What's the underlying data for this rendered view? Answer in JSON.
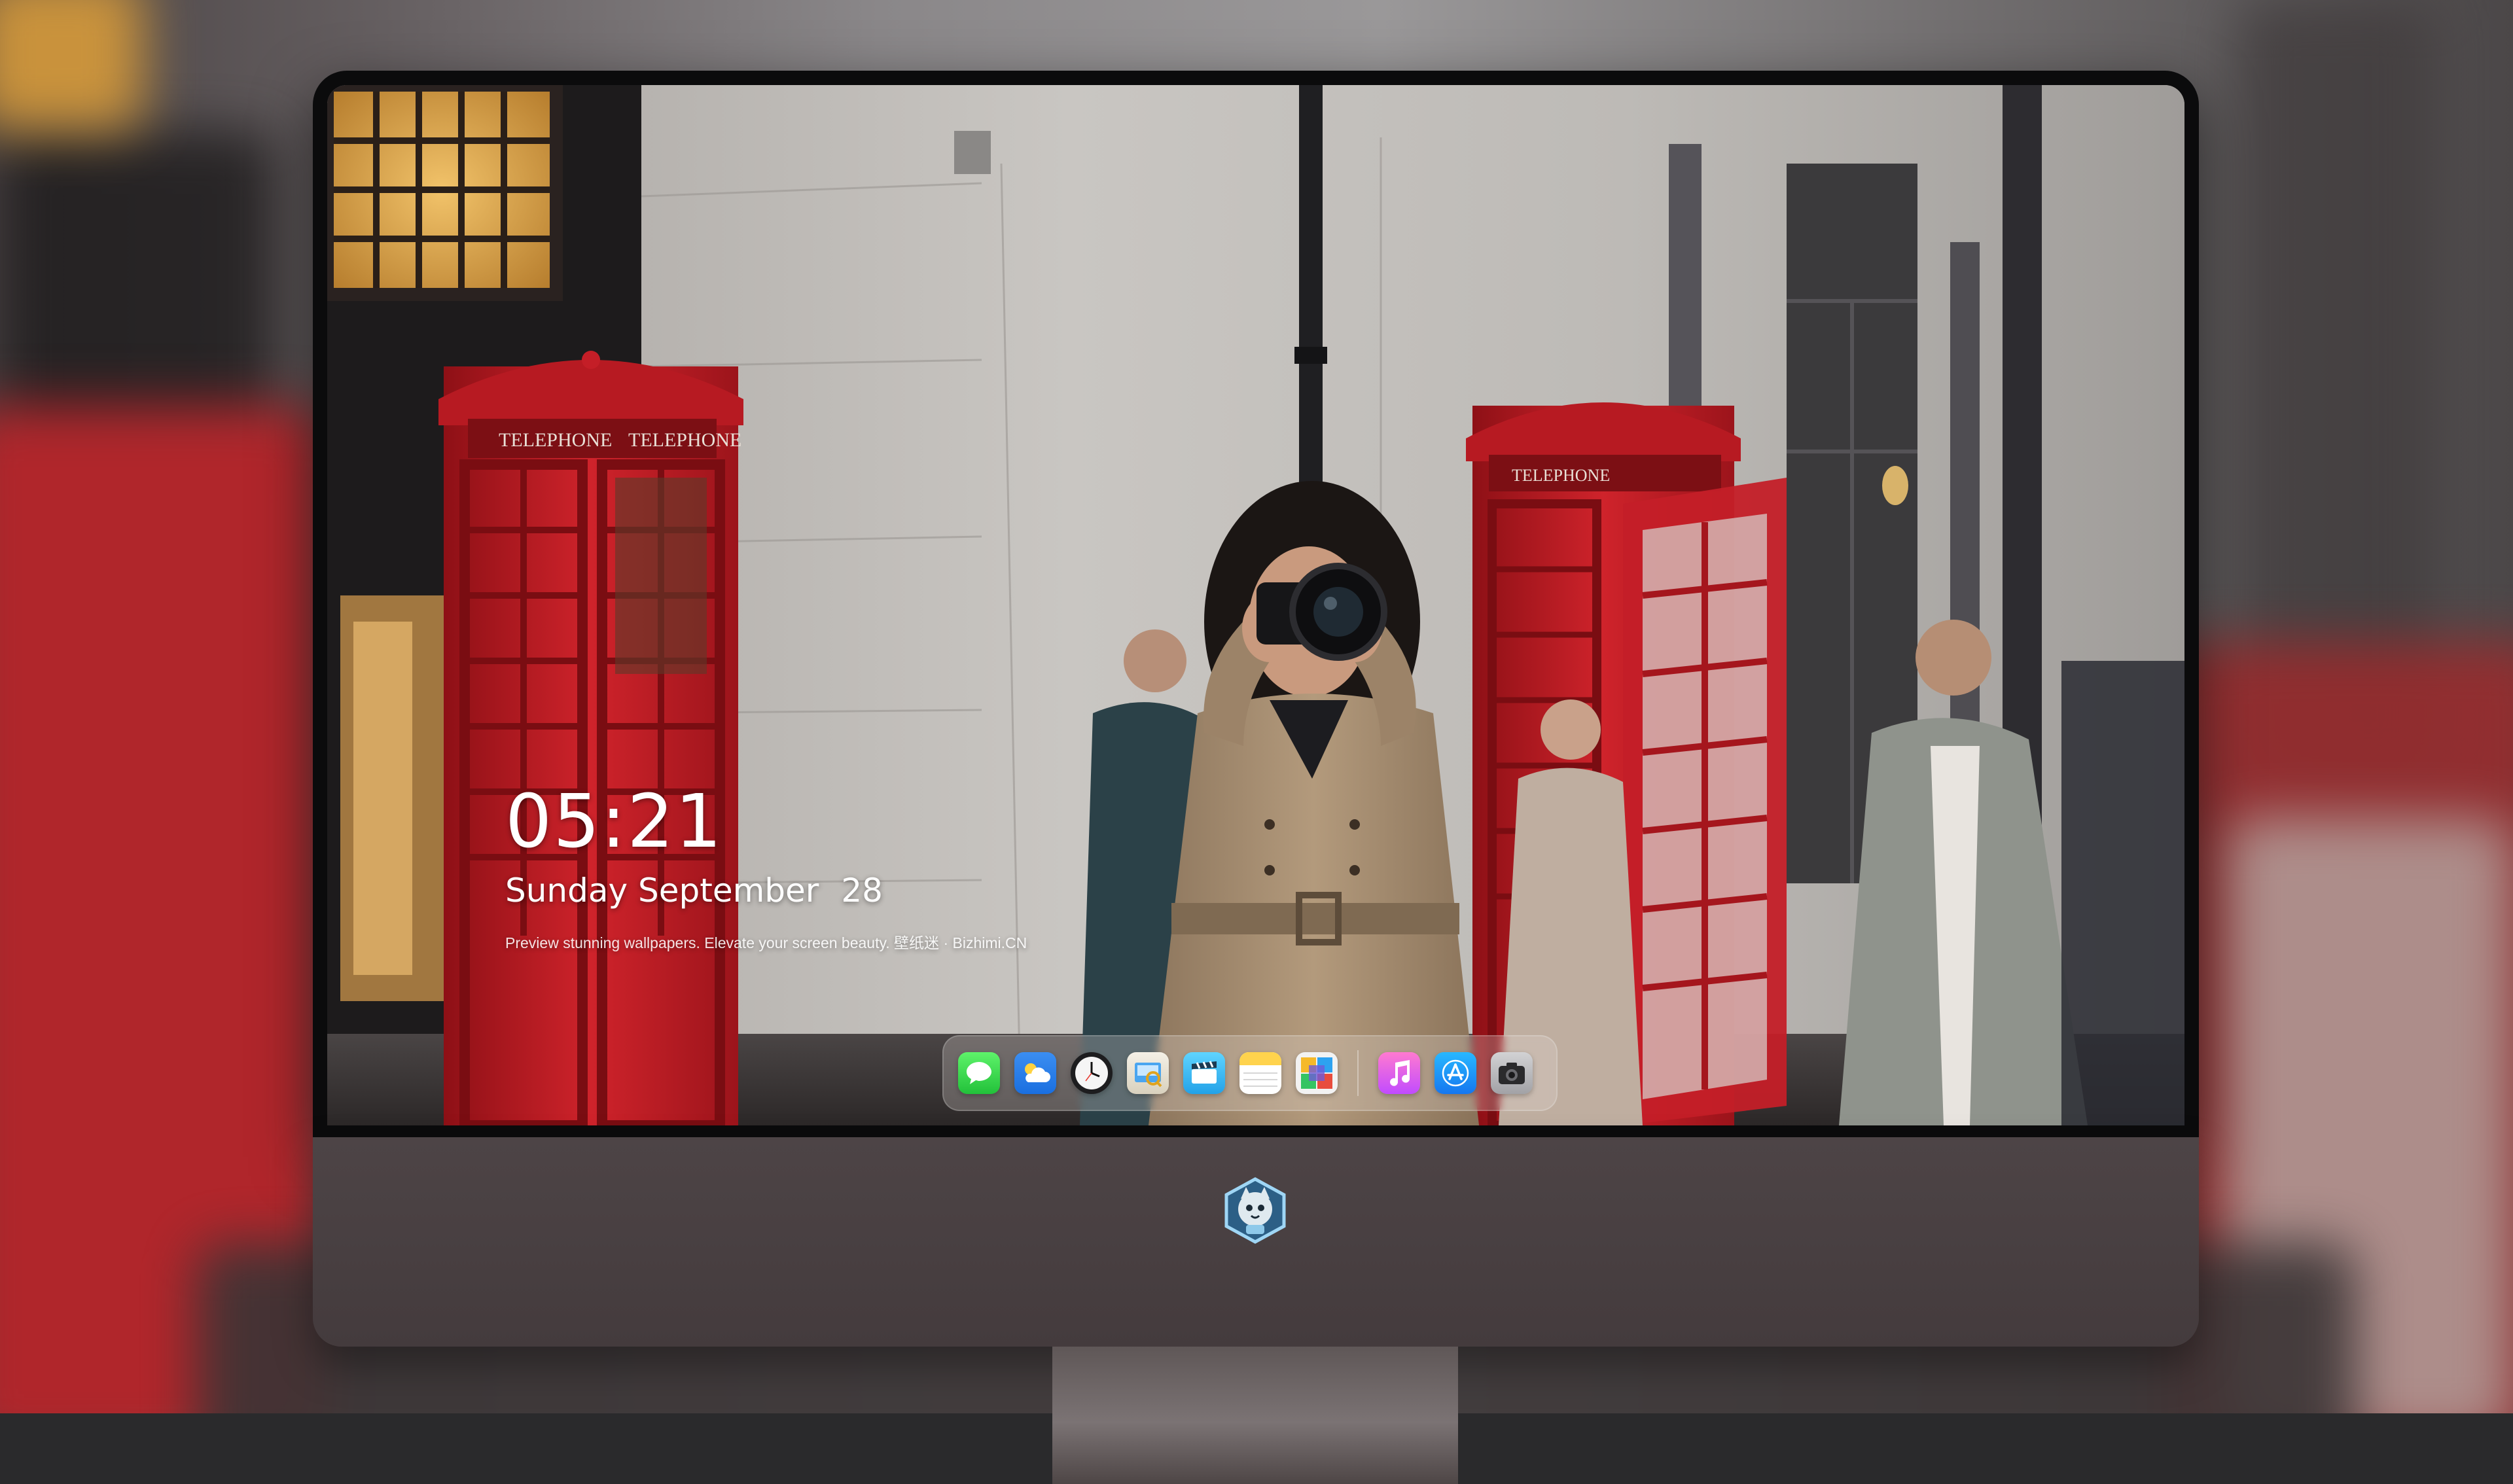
{
  "lockscreen": {
    "time": "05:21",
    "weekday_month": "Sunday September",
    "day": "28",
    "tagline": "Preview stunning wallpapers. Elevate your screen beauty. 壁纸迷 · Bizhimi.CN"
  },
  "phone_booths": {
    "sign_left": "TELEPHONE",
    "sign_right": "TELEPHONE"
  },
  "dock": {
    "apps": [
      {
        "name": "Messages",
        "icon": "messages-icon"
      },
      {
        "name": "Weather",
        "icon": "weather-icon"
      },
      {
        "name": "Clock",
        "icon": "clock-icon"
      },
      {
        "name": "Preview",
        "icon": "preview-icon"
      },
      {
        "name": "Clips",
        "icon": "clips-icon"
      },
      {
        "name": "Notes",
        "icon": "notes-icon"
      },
      {
        "name": "Photo Booth",
        "icon": "photo-booth-icon"
      },
      {
        "name": "Music",
        "icon": "music-icon"
      },
      {
        "name": "App Store",
        "icon": "app-store-icon"
      },
      {
        "name": "Screenshot",
        "icon": "camera-icon"
      }
    ]
  },
  "colors": {
    "booth_red": "#c8202a",
    "chin": "#4a4143",
    "dock_bg": "rgba(225,220,216,0.28)"
  }
}
